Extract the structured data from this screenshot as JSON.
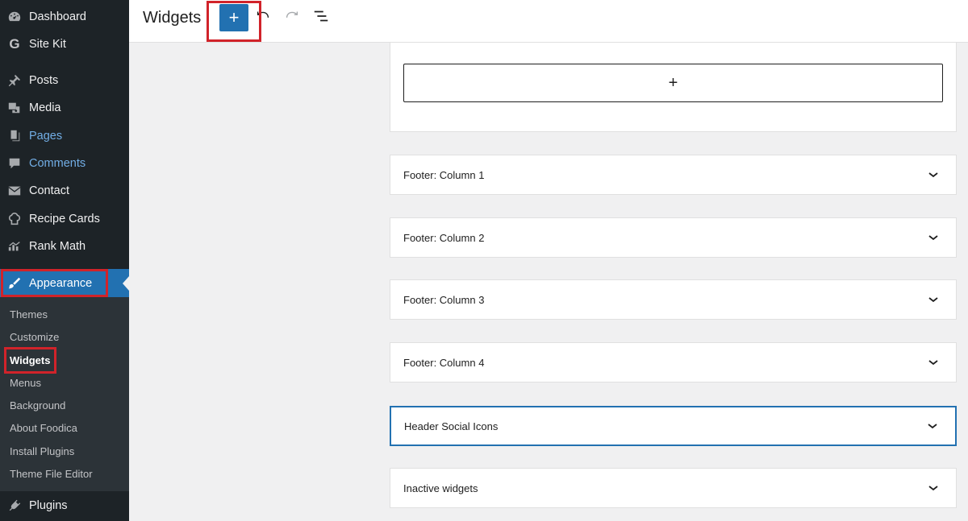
{
  "sidebar": {
    "items": [
      {
        "label": "Dashboard",
        "icon": "dashboard-icon"
      },
      {
        "label": "Site Kit",
        "icon": "google-g-icon"
      },
      {
        "label": "Posts",
        "icon": "pushpin-icon"
      },
      {
        "label": "Media",
        "icon": "media-icon"
      },
      {
        "label": "Pages",
        "icon": "page-icon"
      },
      {
        "label": "Comments",
        "icon": "comment-icon"
      },
      {
        "label": "Contact",
        "icon": "envelope-icon"
      },
      {
        "label": "Recipe Cards",
        "icon": "chef-hat-icon"
      },
      {
        "label": "Rank Math",
        "icon": "rank-math-icon"
      },
      {
        "label": "Appearance",
        "icon": "paintbrush-icon"
      },
      {
        "label": "Plugins",
        "icon": "plug-icon"
      }
    ],
    "submenu": [
      "Themes",
      "Customize",
      "Widgets",
      "Menus",
      "Background",
      "About Foodica",
      "Install Plugins",
      "Theme File Editor"
    ]
  },
  "header": {
    "title": "Widgets",
    "add_label": "+",
    "tools": [
      "undo-icon",
      "redo-icon",
      "list-view-icon"
    ]
  },
  "main": {
    "inserter_label": "+",
    "areas": [
      "Footer: Column 1",
      "Footer: Column 2",
      "Footer: Column 3",
      "Footer: Column 4",
      "Header Social Icons",
      "Inactive widgets"
    ]
  },
  "colors": {
    "sidebar_bg": "#1d2327",
    "submenu_bg": "#2c3338",
    "accent": "#2271b1",
    "highlight_box": "#d1232a",
    "link_blue": "#72aee6"
  }
}
